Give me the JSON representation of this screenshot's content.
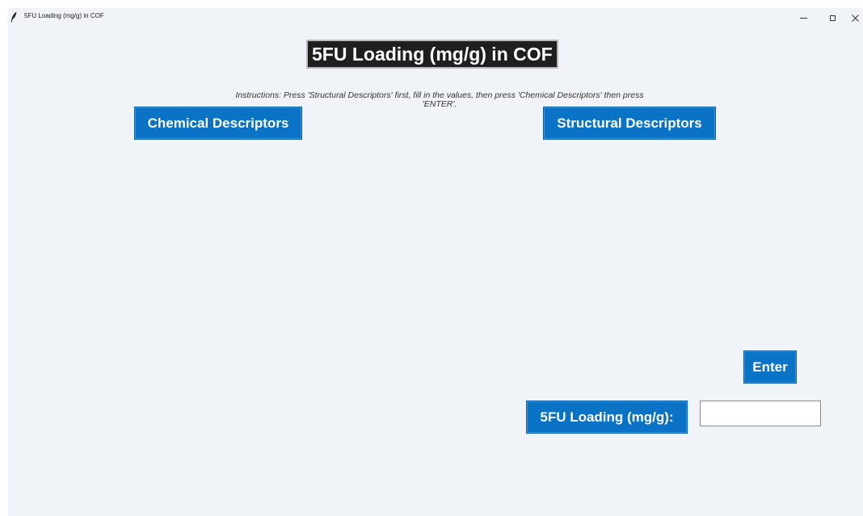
{
  "window": {
    "title": "5FU Loading (mg/g) in COF",
    "app_icon": "feather-icon",
    "controls": {
      "minimize_icon": "minimize-icon",
      "maximize_icon": "maximize-icon",
      "close_icon": "close-icon"
    }
  },
  "header": {
    "title": "5FU Loading (mg/g) in COF",
    "instructions_line1": "Instructions: Press 'Structural Descriptors' first, fill in the values, then press 'Chemical Descriptors' then press",
    "instructions_line2": "'ENTER'."
  },
  "buttons": {
    "chemical_descriptors": "Chemical Descriptors",
    "structural_descriptors": "Structural Descriptors",
    "enter": "Enter"
  },
  "result": {
    "label": "5FU Loading (mg/g):",
    "value": ""
  },
  "colors": {
    "window_bg": "#f0f3f8",
    "button_blue": "#0a73c6",
    "title_bg": "#1f1f1f",
    "button_text": "#ffffff"
  }
}
